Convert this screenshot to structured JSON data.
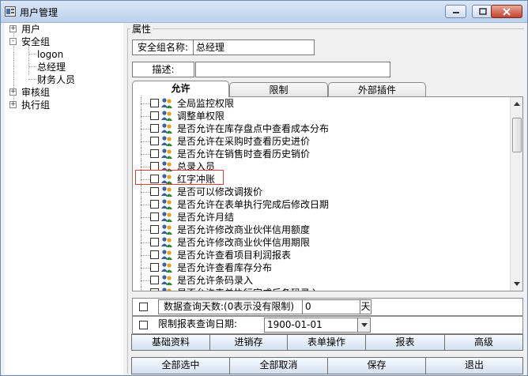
{
  "window": {
    "title": "用户管理",
    "colors": {
      "titlebar": "#bcd1ec",
      "close_button": "#c2432c",
      "highlight": "#e23b3b"
    }
  },
  "tree": {
    "nodes": [
      {
        "label": "用户",
        "expander": "+"
      },
      {
        "label": "安全组",
        "expander": "-"
      },
      {
        "label": "logon"
      },
      {
        "label": "总经理"
      },
      {
        "label": "财务人员"
      },
      {
        "label": "审核组",
        "expander": "+"
      },
      {
        "label": "执行组",
        "expander": "+"
      }
    ]
  },
  "properties": {
    "group_title": "属性",
    "name_label": "安全组名称:",
    "name_value": "总经理",
    "desc_label": "描述:",
    "desc_value": ""
  },
  "tabs": [
    "允许",
    "限制",
    "外部插件"
  ],
  "permissions": [
    "全局监控权限",
    "调整单权限",
    "是否允许在库存盘点中查看成本分布",
    "是否允许在采购时查看历史进价",
    "是否允许在销售时查看历史销价",
    "总录入员",
    "红字冲账",
    "是否可以修改调拨价",
    "是否允许在表单执行完成后修改日期",
    "是否允许月结",
    "是否允许修改商业伙伴信用额度",
    "是否允许修改商业伙伴信用期限",
    "是否允许查看项目利润报表",
    "是否允许查看库存分布",
    "是否允许条码录入",
    "是否允许表单执行完成后条码录入"
  ],
  "options": {
    "query_days_label": "数据查询天数:(0表示没有限制)",
    "query_days_value": "0",
    "query_days_unit": "天",
    "report_date_label": "限制报表查询日期:",
    "report_date_value": "1900-01-01"
  },
  "category_buttons": [
    "基础资料",
    "进销存",
    "表单操作",
    "报表",
    "高级"
  ],
  "action_buttons": [
    "全部选中",
    "全部取消",
    "保存",
    "退出"
  ]
}
